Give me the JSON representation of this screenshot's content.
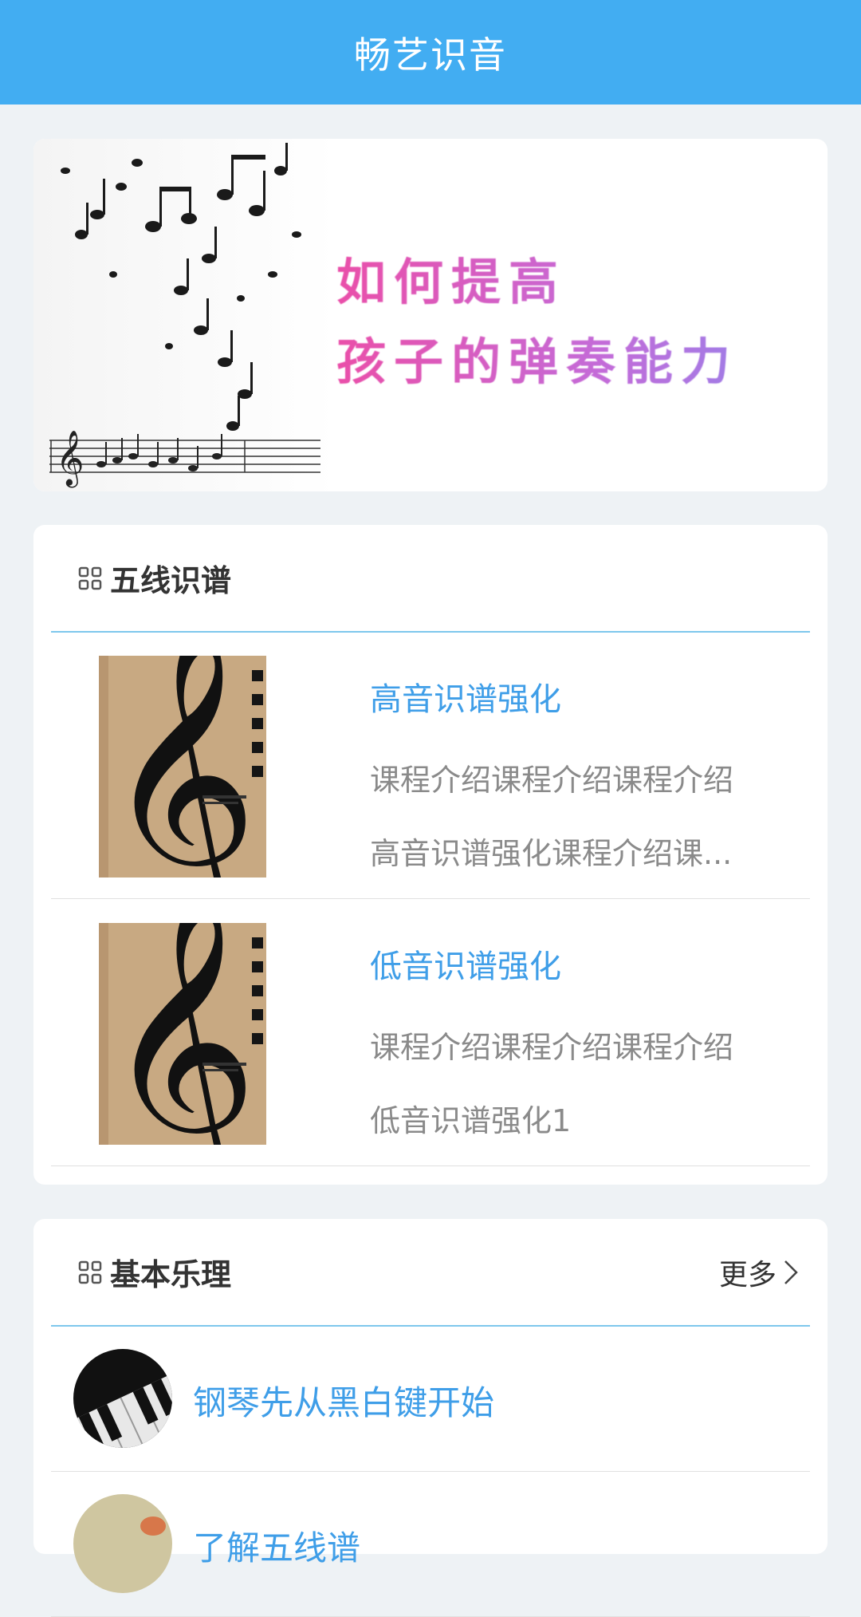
{
  "header": {
    "title": "畅艺识音"
  },
  "banner": {
    "line1": "如何提高",
    "line2": "孩子的弹奏能力"
  },
  "staff_section": {
    "title": "五线识谱",
    "icon": "grid-icon",
    "courses": [
      {
        "title": "高音识谱强化",
        "desc_line1": "课程介绍课程介绍课程介绍",
        "desc_line2": "高音识谱强化课程介绍课..."
      },
      {
        "title": "低音识谱强化",
        "desc_line1": "课程介绍课程介绍课程介绍",
        "desc_line2": "低音识谱强化1"
      }
    ]
  },
  "basic_section": {
    "title": "基本乐理",
    "icon": "grid-icon",
    "more_label": "更多",
    "items": [
      {
        "title": "钢琴先从黑白键开始"
      },
      {
        "title": "了解五线谱"
      }
    ]
  },
  "colors": {
    "header_bg": "#42adf2",
    "accent_text": "#3f9ee8",
    "divider": "#7ec7ec",
    "page_bg": "#eef2f5"
  }
}
